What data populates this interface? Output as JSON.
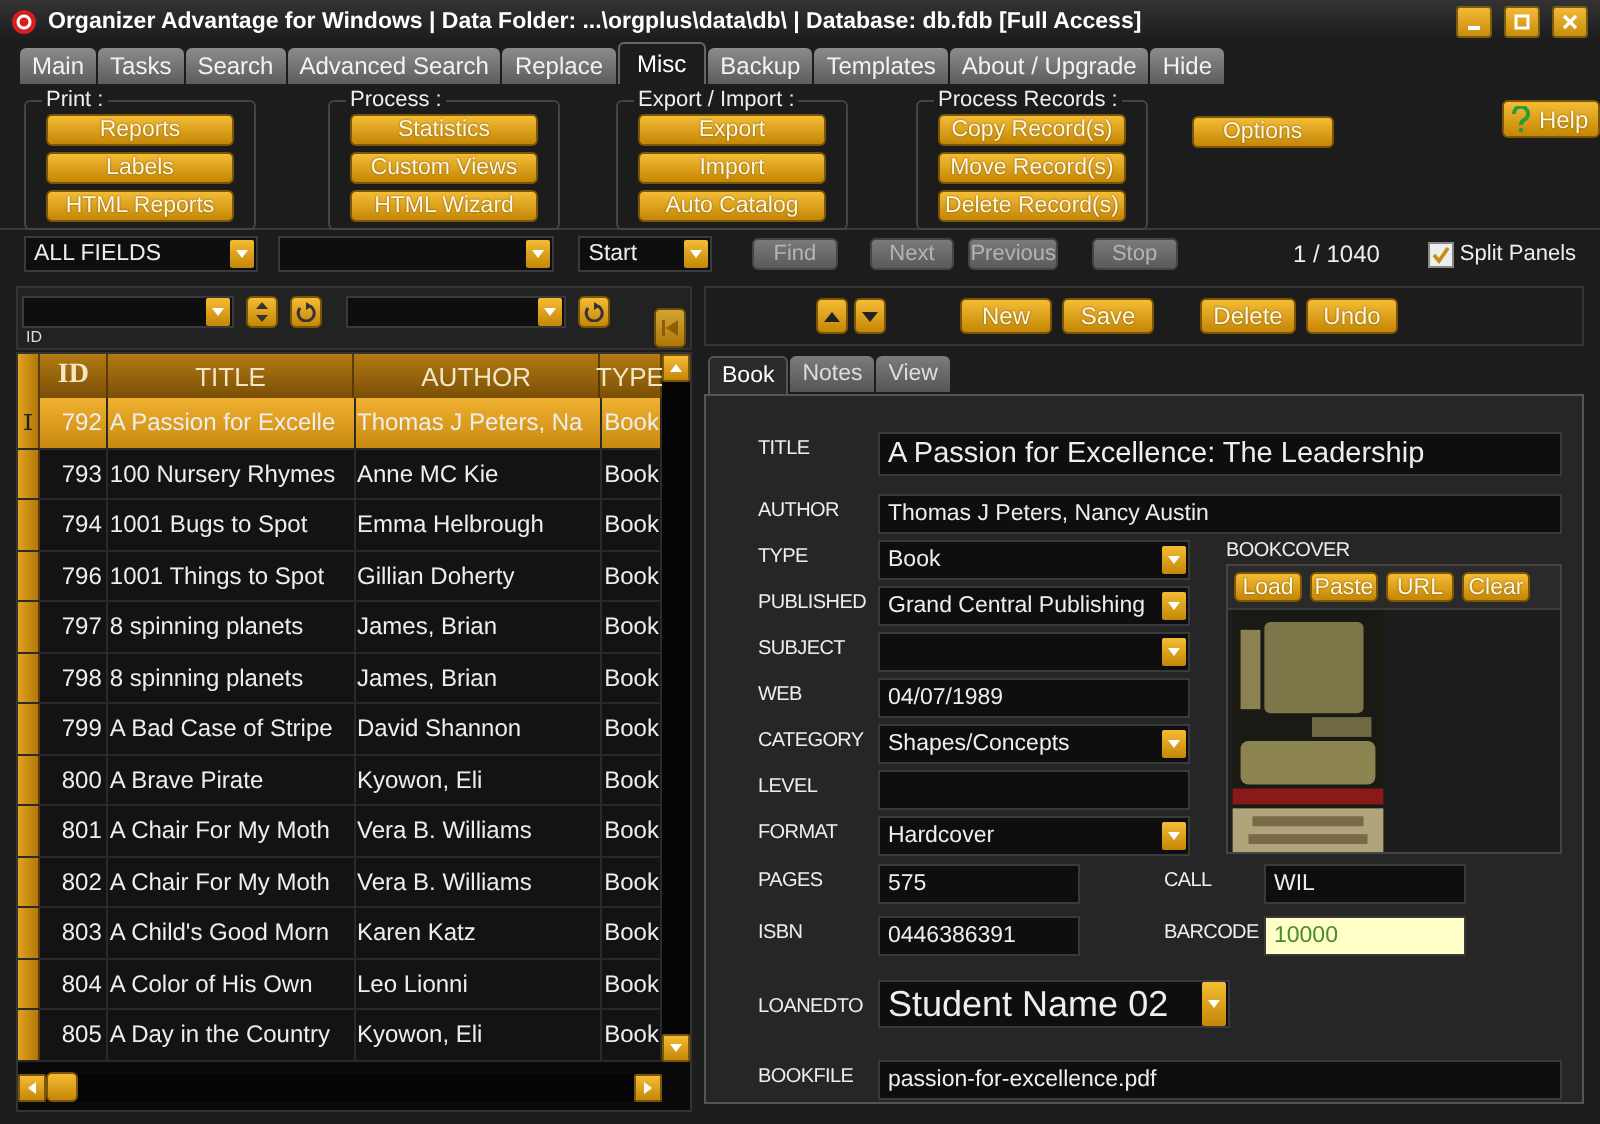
{
  "window": {
    "title": "Organizer Advantage for Windows | Data Folder: ...\\orgplus\\data\\db\\ | Database: db.fdb [Full Access]"
  },
  "tabs": [
    {
      "label": "Main",
      "selected": false
    },
    {
      "label": "Tasks",
      "selected": false
    },
    {
      "label": "Search",
      "selected": false
    },
    {
      "label": "Advanced Search",
      "selected": false
    },
    {
      "label": "Replace",
      "selected": false
    },
    {
      "label": "Misc",
      "selected": true
    },
    {
      "label": "Backup",
      "selected": false
    },
    {
      "label": "Templates",
      "selected": false
    },
    {
      "label": "About / Upgrade",
      "selected": false
    },
    {
      "label": "Hide",
      "selected": false
    }
  ],
  "toolbar": {
    "groups": [
      {
        "title": "Print :",
        "buttons": [
          "Reports",
          "Labels",
          "HTML Reports"
        ]
      },
      {
        "title": "Process :",
        "buttons": [
          "Statistics",
          "Custom Views",
          "HTML Wizard"
        ]
      },
      {
        "title": "Export / Import :",
        "buttons": [
          "Export",
          "Import",
          "Auto Catalog"
        ]
      },
      {
        "title": "Process Records :",
        "buttons": [
          "Copy Record(s)",
          "Move Record(s)",
          "Delete Record(s)"
        ]
      }
    ],
    "options_button": "Options",
    "help_button": "Help"
  },
  "search": {
    "field": "ALL FIELDS",
    "position": "Start",
    "buttons": [
      {
        "label": "Find",
        "disabled": true
      },
      {
        "label": "Next",
        "disabled": true
      },
      {
        "label": "Previous",
        "disabled": true
      },
      {
        "label": "Stop",
        "disabled": true
      }
    ],
    "record_count": "1 / 1040",
    "split_panels": {
      "label": "Split Panels",
      "checked": true
    }
  },
  "filter": {
    "sort_label": "ID"
  },
  "table": {
    "columns": [
      "ID",
      "TITLE",
      "AUTHOR",
      "TYPE"
    ],
    "rows": [
      {
        "id": "792",
        "title": "A Passion for Excelle",
        "author": "Thomas J Peters, Na",
        "type": "Book",
        "selected": true
      },
      {
        "id": "793",
        "title": "100 Nursery Rhymes",
        "author": "Anne MC Kie",
        "type": "Book",
        "selected": false
      },
      {
        "id": "794",
        "title": "1001 Bugs to Spot",
        "author": "Emma Helbrough",
        "type": "Book",
        "selected": false
      },
      {
        "id": "796",
        "title": "1001 Things to Spot",
        "author": "Gillian Doherty",
        "type": "Book",
        "selected": false
      },
      {
        "id": "797",
        "title": "8 spinning planets",
        "author": "James, Brian",
        "type": "Book",
        "selected": false
      },
      {
        "id": "798",
        "title": "8 spinning planets",
        "author": "James, Brian",
        "type": "Book",
        "selected": false
      },
      {
        "id": "799",
        "title": "A Bad Case of Stripe",
        "author": "David Shannon",
        "type": "Book",
        "selected": false
      },
      {
        "id": "800",
        "title": "A Brave Pirate",
        "author": "Kyowon, Eli",
        "type": "Book",
        "selected": false
      },
      {
        "id": "801",
        "title": "A Chair For My Moth",
        "author": "Vera B. Williams",
        "type": "Book",
        "selected": false
      },
      {
        "id": "802",
        "title": "A Chair For My Moth",
        "author": "Vera B. Williams",
        "type": "Book",
        "selected": false
      },
      {
        "id": "803",
        "title": "A Child's Good Morn",
        "author": "Karen Katz",
        "type": "Book",
        "selected": false
      },
      {
        "id": "804",
        "title": "A Color of His Own",
        "author": "Leo Lionni",
        "type": "Book",
        "selected": false
      },
      {
        "id": "805",
        "title": "A Day in the Country",
        "author": "Kyowon, Eli",
        "type": "Book",
        "selected": false
      }
    ]
  },
  "record_toolbar": {
    "buttons": [
      "New",
      "Save",
      "Delete",
      "Undo"
    ]
  },
  "record_tabs": [
    {
      "label": "Book",
      "selected": true
    },
    {
      "label": "Notes",
      "selected": false
    },
    {
      "label": "View",
      "selected": false
    }
  ],
  "form": {
    "top": [
      {
        "label": "TITLE",
        "value": "A Passion for Excellence: The Leadership",
        "kind": "large"
      },
      {
        "label": "AUTHOR",
        "value": "Thomas J Peters, Nancy Austin",
        "kind": "text"
      }
    ],
    "left": [
      {
        "label": "TYPE",
        "value": "Book",
        "kind": "combo"
      },
      {
        "label": "PUBLISHED",
        "value": "Grand Central Publishing",
        "kind": "combo"
      },
      {
        "label": "SUBJECT",
        "kind": "combo"
      },
      {
        "label": "WEB",
        "value": "04/07/1989",
        "kind": "text"
      },
      {
        "label": "CATEGORY",
        "value": "Shapes/Concepts",
        "kind": "combo"
      },
      {
        "label": "LEVEL",
        "kind": "text"
      },
      {
        "label": "FORMAT",
        "value": "Hardcover",
        "kind": "combo"
      }
    ],
    "pairs": [
      [
        {
          "label": "PAGES",
          "value": "575",
          "highlighted": false
        },
        {
          "label": "CALL",
          "value": "WIL",
          "highlighted": false
        }
      ],
      [
        {
          "label": "ISBN",
          "value": "0446386391",
          "highlighted": false
        },
        {
          "label": "BARCODE",
          "value": "10000",
          "highlighted": true
        }
      ]
    ],
    "loaned_to": {
      "label": "LOANEDTO",
      "value": "Student Name 02"
    },
    "bookfile": {
      "label": "BOOKFILE",
      "value": "passion-for-excellence.pdf"
    },
    "bookcover": {
      "label": "BOOKCOVER",
      "buttons": [
        "Load",
        "Paste",
        "URL",
        "Clear"
      ],
      "kind": "picture"
    }
  }
}
